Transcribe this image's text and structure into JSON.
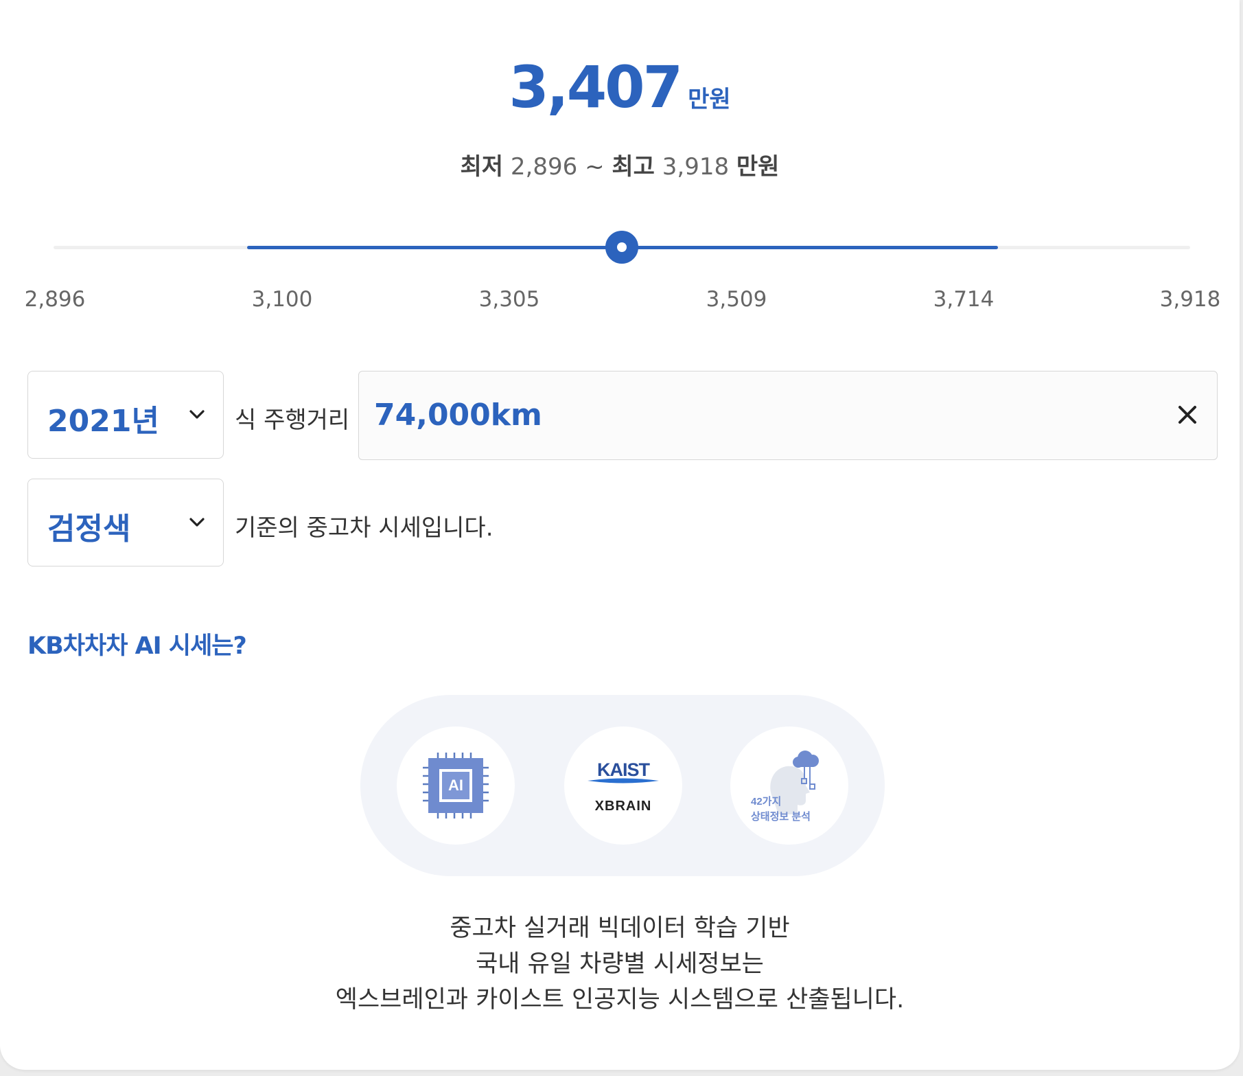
{
  "price": {
    "value": "3,407",
    "unit": "만원"
  },
  "range": {
    "min_label": "최저",
    "min_value": "2,896",
    "separator": "~",
    "max_label": "최고",
    "max_value": "3,918",
    "unit": "만원"
  },
  "slider": {
    "min": 2896,
    "max": 3918,
    "current": 3407,
    "highlight_start": 3070,
    "highlight_end": 3745,
    "ticks": [
      "2,896",
      "3,100",
      "3,305",
      "3,509",
      "3,714",
      "3,918"
    ],
    "accent_color": "#2c63bd"
  },
  "filters": {
    "year": {
      "value": "2021년",
      "icon": "chevron-down-icon"
    },
    "year_suffix": "식 주행거리",
    "mileage": {
      "value": "74,000km",
      "clear_icon": "close-icon"
    },
    "color": {
      "value": "검정색",
      "icon": "chevron-down-icon"
    },
    "color_suffix": "기준의 중고차 시세입니다."
  },
  "info": {
    "title": "KB차차차 AI 시세는?",
    "badges": {
      "ai_chip_label": "AI",
      "kaist_label": "KAIST",
      "xbrain_label": "XBRAIN",
      "analysis_line1": "42가지",
      "analysis_line2": "상태정보 분석"
    },
    "description": [
      "중고차 실거래 빅데이터 학습 기반",
      "국내 유일 차량별 시세정보는",
      "엑스브레인과 카이스트 인공지능 시스템으로 산출됩니다."
    ]
  }
}
